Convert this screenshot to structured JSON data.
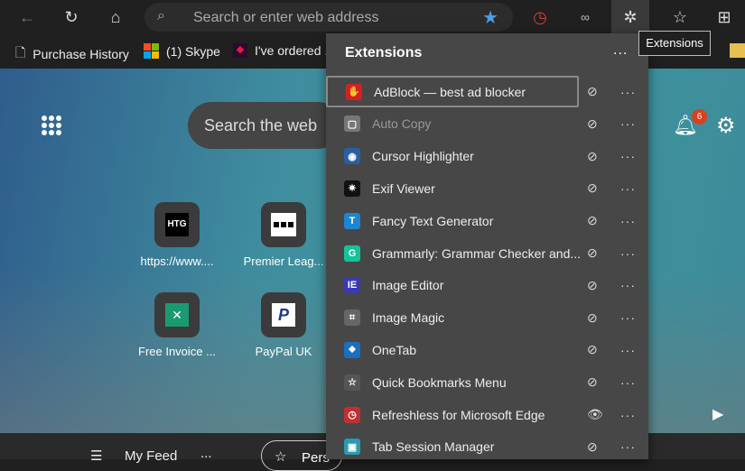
{
  "toolbar": {
    "address_placeholder": "Search or enter web address",
    "tooltip": "Extensions"
  },
  "bookmarks": [
    {
      "label": "Purchase History"
    },
    {
      "label": "(1) Skype"
    },
    {
      "label": "I've ordered ..."
    }
  ],
  "newtab": {
    "search_placeholder": "Search the web",
    "notification_count": "6",
    "tiles": [
      {
        "label": "https://www....",
        "icon": "HTG"
      },
      {
        "label": "Premier Leag..."
      },
      {
        "label": "Free Invoice ..."
      },
      {
        "label": "PayPal UK"
      }
    ],
    "feed_label": "My Feed",
    "feed_more": "...",
    "personalize_label": "Pers"
  },
  "extensions": {
    "title": "Extensions",
    "more": "...",
    "items": [
      {
        "name": "AdBlock — best ad blocker",
        "color": "#d42020",
        "glyph": "✋",
        "visible": false
      },
      {
        "name": "Auto Copy",
        "color": "#777",
        "glyph": "▢",
        "visible": false,
        "dim": true
      },
      {
        "name": "Cursor Highlighter",
        "color": "#2a5fa0",
        "glyph": "◉",
        "visible": false
      },
      {
        "name": "Exif Viewer",
        "color": "#111",
        "glyph": "✷",
        "visible": false
      },
      {
        "name": "Fancy Text Generator",
        "color": "#1c86d0",
        "glyph": "T",
        "visible": false
      },
      {
        "name": "Grammarly: Grammar Checker and...",
        "color": "#15c39a",
        "glyph": "G",
        "visible": false
      },
      {
        "name": "Image Editor",
        "color": "#3a3ab0",
        "glyph": "IE",
        "visible": false
      },
      {
        "name": "Image Magic",
        "color": "#666",
        "glyph": "⌗",
        "visible": false
      },
      {
        "name": "OneTab",
        "color": "#1a6fc0",
        "glyph": "⬥",
        "visible": false
      },
      {
        "name": "Quick Bookmarks Menu",
        "color": "#555",
        "glyph": "☆",
        "visible": false
      },
      {
        "name": "Refreshless for Microsoft Edge",
        "color": "#c03030",
        "glyph": "◷",
        "visible": true
      },
      {
        "name": "Tab Session Manager",
        "color": "#2a9ab0",
        "glyph": "▣",
        "visible": false
      }
    ]
  }
}
